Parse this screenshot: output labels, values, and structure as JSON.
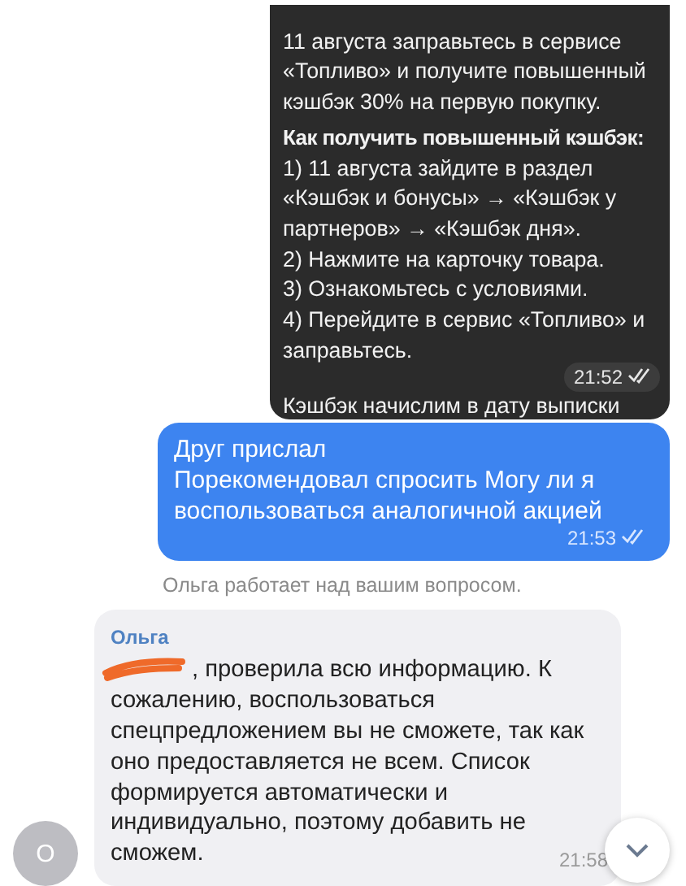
{
  "messages": [
    {
      "kind": "outgoing_card",
      "intro": "11 августа заправьтесь в сервисе «Топливо» и получите повышенный кэшбэк 30% на первую покупку.",
      "heading": "Как получить повышенный кэшбэк:",
      "steps": [
        "1) 11 августа зайдите в раздел «Кэшбэк и бонусы» → «Кэшбэк у партнеров» → «Кэшбэк дня».",
        "2) Нажмите на карточку товара.",
        "3) Ознакомьтесь с условиями.",
        "4) Перейдите в сервис «Топливо» и заправьтесь."
      ],
      "time": "21:52",
      "read": true,
      "continuation": "Кэшбэк начислим в дату выписки"
    },
    {
      "kind": "outgoing",
      "lines": [
        "Друг прислал",
        "Порекомендовал спросить Могу ли я воспользоваться аналогичной акцией"
      ],
      "time": "21:53",
      "read": true
    },
    {
      "kind": "status",
      "text": "Ольга работает над вашим вопросом."
    },
    {
      "kind": "incoming",
      "author": "Ольга",
      "avatar": "О",
      "redacted": true,
      "text": ", проверила всю информацию. К сожалению, воспользоваться спецпредложением вы не сможете, так как оно предоставляется не всем. Список формируется автоматически и индивидуально, поэтому добавить не сможем.",
      "time": "21:58"
    }
  ]
}
